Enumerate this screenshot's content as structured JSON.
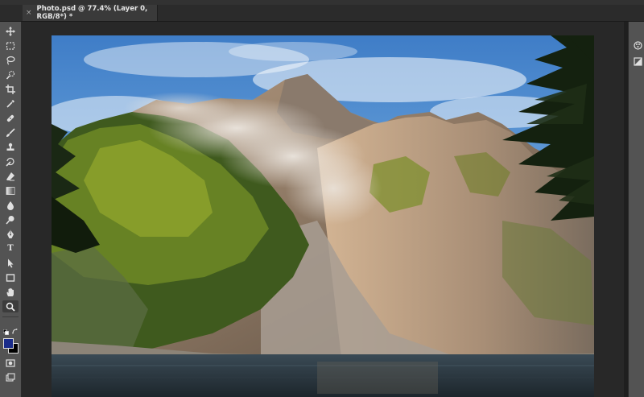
{
  "document_tab": {
    "close_glyph": "×",
    "title": "Photo.psd @ 77.4% (Layer 0, RGB/8*) *"
  },
  "tools": [
    {
      "name": "move-tool",
      "icon": "move-icon"
    },
    {
      "name": "marquee-tool",
      "icon": "rect-marquee-icon"
    },
    {
      "name": "lasso-tool",
      "icon": "lasso-icon"
    },
    {
      "name": "quick-select-tool",
      "icon": "quick-select-icon"
    },
    {
      "name": "crop-tool",
      "icon": "crop-icon"
    },
    {
      "name": "eyedropper-tool",
      "icon": "eyedropper-icon"
    },
    {
      "name": "healing-brush-tool",
      "icon": "bandage-icon"
    },
    {
      "name": "brush-tool",
      "icon": "brush-icon"
    },
    {
      "name": "clone-stamp-tool",
      "icon": "stamp-icon"
    },
    {
      "name": "history-brush-tool",
      "icon": "history-brush-icon"
    },
    {
      "name": "eraser-tool",
      "icon": "eraser-icon"
    },
    {
      "name": "gradient-tool",
      "icon": "gradient-icon"
    },
    {
      "name": "blur-tool",
      "icon": "drop-icon"
    },
    {
      "name": "dodge-tool",
      "icon": "dodge-icon"
    },
    {
      "name": "pen-tool",
      "icon": "pen-icon"
    },
    {
      "name": "type-tool",
      "icon": "type-icon",
      "label": "T"
    },
    {
      "name": "path-select-tool",
      "icon": "arrow-icon"
    },
    {
      "name": "shape-tool",
      "icon": "rectangle-icon"
    },
    {
      "name": "hand-tool",
      "icon": "hand-icon"
    },
    {
      "name": "zoom-tool",
      "icon": "magnifier-icon",
      "active": true
    }
  ],
  "colors": {
    "foreground": "#1a2c8a",
    "background": "#000000"
  },
  "panel_buttons": [
    "color-panel-icon",
    "adjustments-icon"
  ]
}
